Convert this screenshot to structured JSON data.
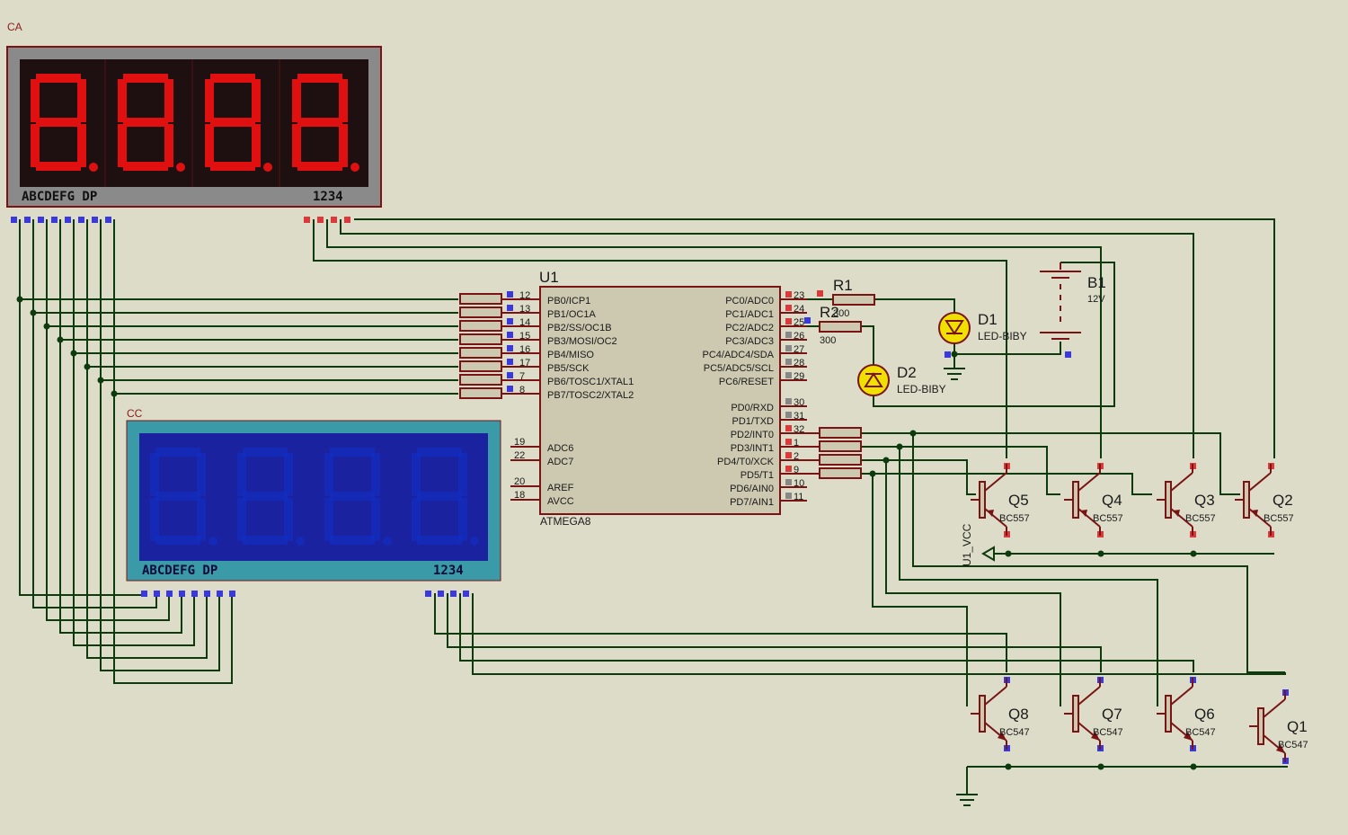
{
  "labels": {
    "ca_display": "CA",
    "cc_display": "CC",
    "ca_seg_label": "ABCDEFG  DP",
    "ca_digit_label": "1234",
    "cc_seg_label": "ABCDEFG  DP",
    "cc_digit_label": "1234"
  },
  "mcu": {
    "ref": "U1",
    "part": "ATMEGA8",
    "left_pins": [
      {
        "num": "12",
        "name": "PB0/ICP1"
      },
      {
        "num": "13",
        "name": "PB1/OC1A"
      },
      {
        "num": "14",
        "name": "PB2/SS/OC1B"
      },
      {
        "num": "15",
        "name": "PB3/MOSI/OC2"
      },
      {
        "num": "16",
        "name": "PB4/MISO"
      },
      {
        "num": "17",
        "name": "PB5/SCK"
      },
      {
        "num": "7",
        "name": "PB6/TOSC1/XTAL1"
      },
      {
        "num": "8",
        "name": "PB7/TOSC2/XTAL2"
      }
    ],
    "left_pins2": [
      {
        "num": "19",
        "name": "ADC6"
      },
      {
        "num": "22",
        "name": "ADC7"
      },
      {
        "num": "20",
        "name": "AREF"
      },
      {
        "num": "18",
        "name": "AVCC"
      }
    ],
    "right_pins": [
      {
        "num": "23",
        "name": "PC0/ADC0"
      },
      {
        "num": "24",
        "name": "PC1/ADC1"
      },
      {
        "num": "25",
        "name": "PC2/ADC2"
      },
      {
        "num": "26",
        "name": "PC3/ADC3"
      },
      {
        "num": "27",
        "name": "PC4/ADC4/SDA"
      },
      {
        "num": "28",
        "name": "PC5/ADC5/SCL"
      },
      {
        "num": "29",
        "name": "PC6/RESET"
      }
    ],
    "right_pins2": [
      {
        "num": "30",
        "name": "PD0/RXD"
      },
      {
        "num": "31",
        "name": "PD1/TXD"
      },
      {
        "num": "32",
        "name": "PD2/INT0"
      },
      {
        "num": "1",
        "name": "PD3/INT1"
      },
      {
        "num": "2",
        "name": "PD4/T0/XCK"
      },
      {
        "num": "9",
        "name": "PD5/T1"
      },
      {
        "num": "10",
        "name": "PD6/AIN0"
      },
      {
        "num": "11",
        "name": "PD7/AIN1"
      }
    ]
  },
  "resistors": [
    {
      "ref": "R1",
      "value": "300"
    },
    {
      "ref": "R2",
      "value": "300"
    }
  ],
  "leds": [
    {
      "ref": "D1",
      "part": "LED-BIBY"
    },
    {
      "ref": "D2",
      "part": "LED-BIBY"
    }
  ],
  "battery": {
    "ref": "B1",
    "value": "12V"
  },
  "pnp": [
    {
      "ref": "Q5",
      "part": "BC557"
    },
    {
      "ref": "Q4",
      "part": "BC557"
    },
    {
      "ref": "Q3",
      "part": "BC557"
    },
    {
      "ref": "Q2",
      "part": "BC557"
    }
  ],
  "npn": [
    {
      "ref": "Q8",
      "part": "BC547"
    },
    {
      "ref": "Q7",
      "part": "BC547"
    },
    {
      "ref": "Q6",
      "part": "BC547"
    },
    {
      "ref": "Q1",
      "part": "BC547"
    }
  ],
  "power_label": "U1_VCC",
  "colors": {
    "background": "#dcdcc8",
    "wire": "#0d3b0d",
    "component": "#7a1414",
    "segment_on": "#e01010",
    "cc_display_bg": "#1a22a0",
    "cc_frame": "#3a9aa8"
  }
}
